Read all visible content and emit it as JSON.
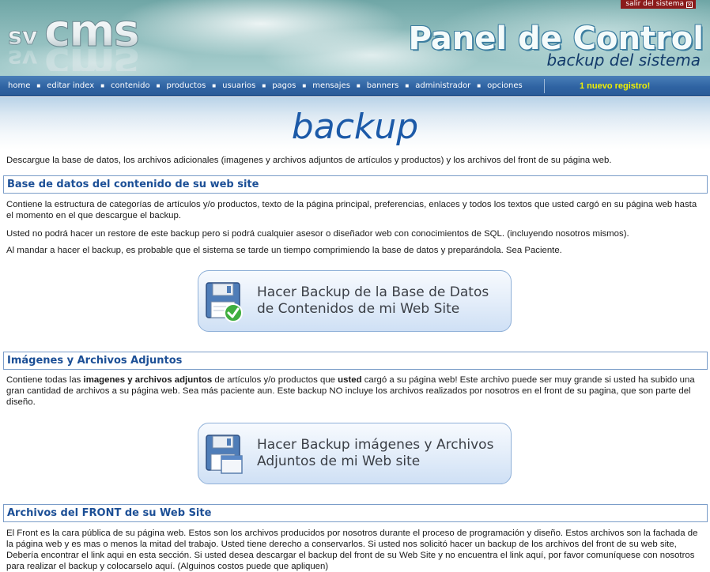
{
  "header": {
    "logo_text": "svcms",
    "exit_label": "salir del sistema",
    "title": "Panel de Control",
    "subtitle": "backup del sistema"
  },
  "nav": {
    "items": [
      "home",
      "editar index",
      "contenido",
      "productos",
      "usuarios",
      "pagos",
      "mensajes",
      "banners",
      "administrador",
      "opciones"
    ],
    "alert": "1 nuevo registro!"
  },
  "page": {
    "title": "backup",
    "intro": "Descargue  la base de datos, los archivos adicionales (imagenes y archivos adjuntos de artículos y productos) y los archivos del front de su  página web."
  },
  "sections": {
    "database": {
      "heading": "Base de datos del contenido de su web site",
      "p1": "Contiene la estructura de categorías de artículos y/o productos, texto de la  página principal, preferencias,  enlaces y todos los textos que usted cargó en su página web hasta el momento en el que descargue el backup.",
      "p2": "Usted no  podrá hacer un restore de este backup pero si podrá cualquier asesor  o diseñador web con conocimientos de SQL. (incluyendo nosotros mismos).",
      "p3": "Al mandar a hacer el  backup, es probable que el sistema se tarde un tiempo comprimiendo la base de datos y preparándola. Sea Paciente.",
      "button_label": "Hacer Backup de la  Base de Datos de Contenidos de mi Web Site"
    },
    "images": {
      "heading": "Imágenes y Archivos Adjuntos",
      "p1_a": "Contiene todas las ",
      "p1_b": "imagenes y archivos adjuntos",
      "p1_c": " de artículos y/o productos que  ",
      "p1_d": "usted",
      "p1_e": " cargó a su página web! Este archivo puede ser muy grande si  usted ha subido una gran cantidad de archivos a su página web. Sea más paciente aun. Este backup NO incluye los archivos realizados por nosotros en el front de su pagina, que son parte del diseño.",
      "button_label": "Hacer Backup imágenes y Archivos Adjuntos de mi  Web site"
    },
    "front": {
      "heading": "Archivos del FRONT de su Web Site",
      "p1": "El Front es  la cara pública de su  página web. Estos son los archivos producidos por nosotros durante el proceso de programación y diseño. Estos archivos son la fachada de la  página web y es mas o menos la mitad del trabajo. Usted tiene derecho a conservarlos. Si usted nos solicitó hacer un backup de los archivos  del front de su web site, Debería encontrar el link aqui en esta sección. Si usted desea descargar el backup  del front de su Web Site y no encuentra el link aquí, por favor comuníquese con nosotros  para realizar el backup y colocarselo aquí. (Alguinos costos puede que apliquen)"
    }
  },
  "colors": {
    "nav_bg": "#2f63a3",
    "alert": "#f0f000",
    "heading": "#1c4f96",
    "title": "#1c5aa8"
  }
}
